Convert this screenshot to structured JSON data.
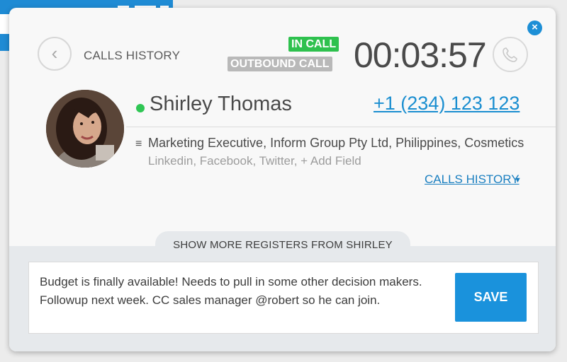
{
  "app": {
    "calls_history_top_label": "CALLS HISTORY",
    "back_icon": "chevron-left-icon",
    "close_icon": "close-icon",
    "phone_icon": "phone-icon"
  },
  "call": {
    "status_badge": "IN CALL",
    "direction_badge": "OUTBOUND CALL",
    "timer": "00:03:57",
    "status_color": "#2ec14e"
  },
  "contact": {
    "name": "Shirley Thomas",
    "phone": "+1 (234) 123 123",
    "presence_color": "#2fc654",
    "details": "Marketing Executive, Inform Group Pty Ltd, Philippines, Cosmetics",
    "links": [
      "Linkedin",
      "Facebook",
      "Twitter",
      "+ Add Field"
    ],
    "calls_history_link": "CALLS HISTORY"
  },
  "registers": {
    "show_more_label": "SHOW MORE REGISTERS FROM SHIRLEY"
  },
  "note": {
    "text": "Budget is finally available! Needs to pull in some other decision makers. Followup next week. CC sales manager @robert so he can join.",
    "save_label": "SAVE"
  },
  "colors": {
    "accent": "#1a8ed0",
    "save_button": "#1a92dc"
  }
}
